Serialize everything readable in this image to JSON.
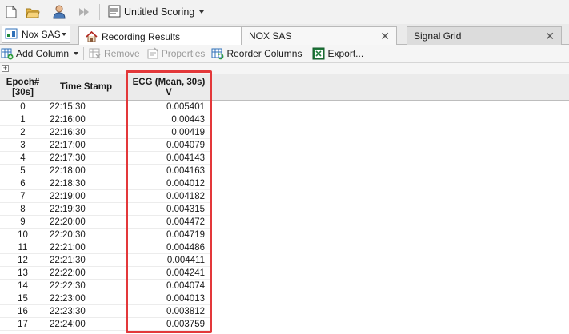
{
  "toolbar": {
    "scoring_label": "Untitled Scoring"
  },
  "tabs": {
    "profile_label": "Nox SAS",
    "items": [
      {
        "label": "Recording Results"
      },
      {
        "label": "NOX SAS"
      },
      {
        "label": "Signal Grid"
      }
    ]
  },
  "actions": {
    "add_column": "Add Column",
    "remove": "Remove",
    "properties": "Properties",
    "reorder_columns": "Reorder Columns",
    "export": "Export..."
  },
  "grid": {
    "headers": {
      "epoch_line1": "Epoch#",
      "epoch_line2": "[30s]",
      "timestamp": "Time Stamp",
      "ecg_line1": "ECG (Mean, 30s)",
      "ecg_line2": "V"
    },
    "rows": [
      {
        "epoch": "0",
        "time": "22:15:30",
        "ecg": "0.005401"
      },
      {
        "epoch": "1",
        "time": "22:16:00",
        "ecg": "0.00443"
      },
      {
        "epoch": "2",
        "time": "22:16:30",
        "ecg": "0.00419"
      },
      {
        "epoch": "3",
        "time": "22:17:00",
        "ecg": "0.004079"
      },
      {
        "epoch": "4",
        "time": "22:17:30",
        "ecg": "0.004143"
      },
      {
        "epoch": "5",
        "time": "22:18:00",
        "ecg": "0.004163"
      },
      {
        "epoch": "6",
        "time": "22:18:30",
        "ecg": "0.004012"
      },
      {
        "epoch": "7",
        "time": "22:19:00",
        "ecg": "0.004182"
      },
      {
        "epoch": "8",
        "time": "22:19:30",
        "ecg": "0.004315"
      },
      {
        "epoch": "9",
        "time": "22:20:00",
        "ecg": "0.004472"
      },
      {
        "epoch": "10",
        "time": "22:20:30",
        "ecg": "0.004719"
      },
      {
        "epoch": "11",
        "time": "22:21:00",
        "ecg": "0.004486"
      },
      {
        "epoch": "12",
        "time": "22:21:30",
        "ecg": "0.004411"
      },
      {
        "epoch": "13",
        "time": "22:22:00",
        "ecg": "0.004241"
      },
      {
        "epoch": "14",
        "time": "22:22:30",
        "ecg": "0.004074"
      },
      {
        "epoch": "15",
        "time": "22:23:00",
        "ecg": "0.004013"
      },
      {
        "epoch": "16",
        "time": "22:23:30",
        "ecg": "0.003812"
      },
      {
        "epoch": "17",
        "time": "22:24:00",
        "ecg": "0.003759"
      }
    ]
  },
  "colors": {
    "highlight": "#e3383a"
  }
}
